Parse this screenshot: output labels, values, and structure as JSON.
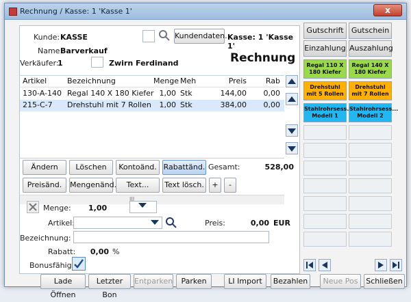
{
  "window": {
    "title": "Rechnung / Kasse: 1 'Kasse 1'",
    "close": "x"
  },
  "header": {
    "kunde_label": "Kunde:",
    "kunde_value": "KASSE",
    "kundendaten_button": "Kundendaten...",
    "kasse_value": "Kasse: 1 'Kasse 1'",
    "name_label": "Name:",
    "name_value": "Barverkauf",
    "verkaeufer_label": "Verkäufer:",
    "verkaeufer_value": "1",
    "verkaeufer_name": "Zwirn Ferdinand",
    "doc_title": "Rechnung"
  },
  "table": {
    "columns": [
      "Artikel",
      "Bezeichnung",
      "Menge",
      "Meh",
      "Preis",
      "Rab"
    ],
    "rows": [
      {
        "artikel": "130-A-140",
        "bezeichnung": "Regal 140 X 180 Kiefer",
        "menge": "1,00",
        "meh": "Stk",
        "preis": "144,00",
        "rab": "0,00"
      },
      {
        "artikel": "215-C-7",
        "bezeichnung": "Drehstuhl mit 7 Rollen",
        "menge": "1,00",
        "meh": "Stk",
        "preis": "384,00",
        "rab": "0,00"
      }
    ],
    "hscroll_mark": "III"
  },
  "actions": {
    "row1": [
      "Ändern",
      "Löschen",
      "Kontoänd.",
      "Rabattänd."
    ],
    "gesamt_label": "Gesamt:",
    "gesamt_value": "528,00",
    "row2": [
      "Preisänd.",
      "Mengenänd.",
      "Text...",
      "Text lösch."
    ],
    "plus": "+",
    "minus": "-"
  },
  "entry": {
    "menge_label": "Menge:",
    "menge_value": "1,00",
    "artikel_label": "Artikel:",
    "preis_label": "Preis:",
    "preis_value": "0,00",
    "currency": "EUR",
    "bezeichnung_label": "Bezeichnung:",
    "rabatt_label": "Rabatt:",
    "rabatt_value": "0,00",
    "rabatt_unit": "%",
    "bonus_label": "Bonusfähig:"
  },
  "sidebar": {
    "buttons": [
      "Gutschrift",
      "Gutschein",
      "Einzahlung",
      "Auszahlung"
    ],
    "tiles": [
      {
        "label": "Regal 110 X 180 Kiefer",
        "color": "#9bd84a"
      },
      {
        "label": "Regal 140 X 180 Kiefer",
        "color": "#9bd84a"
      },
      {
        "label": "Drehstuhl mit 5 Rollen",
        "color": "#ffb000"
      },
      {
        "label": "Drehstuhl mit 7 Rollen",
        "color": "#ffb000"
      },
      {
        "label": "Stahlrohrsess... Modell 1",
        "color": "#22b7f0"
      },
      {
        "label": "Stahlrohrsess... Modell 2",
        "color": "#22b7f0"
      }
    ]
  },
  "footer": [
    "Lade Öffnen",
    "Letzter Bon",
    "Entparken",
    "Parken",
    "LI Import",
    "Bezahlen",
    "Neue Pos",
    "Schließen"
  ]
}
